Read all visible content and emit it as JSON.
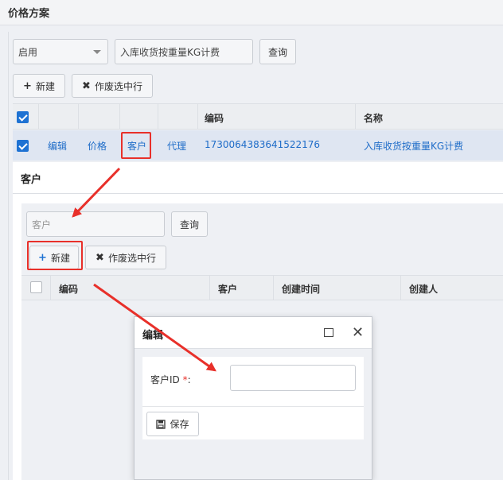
{
  "page": {
    "title": "价格方案"
  },
  "filters": {
    "status_value": "启用",
    "search_value": "入库收货按重量KG计费",
    "query_label": "查询"
  },
  "toolbar": {
    "new_label": "新建",
    "void_label": "作废选中行"
  },
  "table": {
    "headers": {
      "code": "编码",
      "name": "名称"
    },
    "row": {
      "edit": "编辑",
      "price": "价格",
      "customer": "客户",
      "agent": "代理",
      "code": "1730064383641522176",
      "name": "入库收货按重量KG计费"
    }
  },
  "customer_dialog": {
    "title": "客户",
    "search_placeholder": "客户",
    "query_label": "查询",
    "new_label": "新建",
    "void_label": "作废选中行",
    "headers": {
      "code": "编码",
      "customer": "客户",
      "created_time": "创建时间",
      "creator": "创建人"
    }
  },
  "edit_dialog": {
    "title": "编辑",
    "customer_id_label": "客户ID",
    "required_mark": "*",
    "colon": ":",
    "customer_id_value": "",
    "save_label": "保存"
  },
  "colors": {
    "accent": "#1e72d3",
    "link": "#1e6cc8",
    "annotation": "#e8302a"
  }
}
